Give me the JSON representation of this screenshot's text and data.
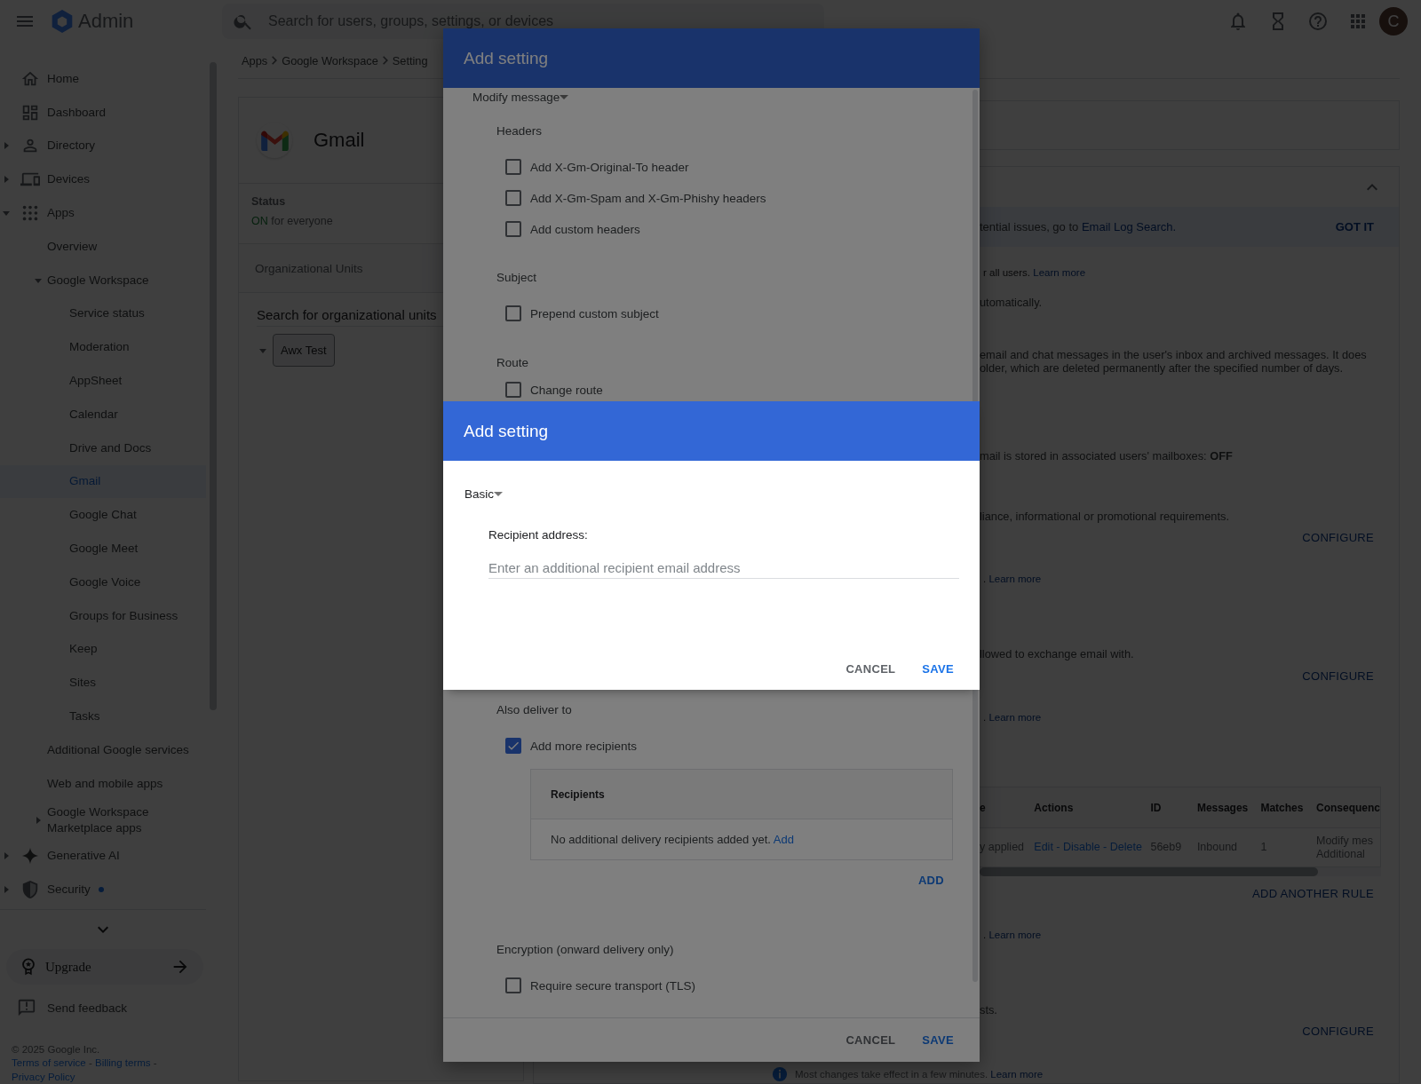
{
  "top_bar": {
    "product": "Admin",
    "search": {
      "placeholder": "Search for users, groups, settings, or devices"
    },
    "avatar": "C"
  },
  "sidebar": {
    "items": [
      {
        "label": "Home",
        "selected": false
      },
      {
        "label": "Dashboard",
        "selected": false
      },
      {
        "label": "Directory",
        "selected": false,
        "expanded": false
      },
      {
        "label": "Devices",
        "selected": false,
        "expanded": false
      },
      {
        "label": "Apps",
        "selected": false,
        "expanded": true,
        "children": [
          {
            "label": "Overview",
            "selected": false
          },
          {
            "label": "Google Workspace",
            "selected": false,
            "expanded": true,
            "children": [
              {
                "label": "Service status",
                "selected": false
              },
              {
                "label": "Moderation",
                "selected": false
              },
              {
                "label": "AppSheet",
                "selected": false
              },
              {
                "label": "Calendar",
                "selected": false
              },
              {
                "label": "Drive and Docs",
                "selected": false
              },
              {
                "label": "Gmail",
                "selected": true
              },
              {
                "label": "Google Chat",
                "selected": false
              },
              {
                "label": "Google Meet",
                "selected": false
              },
              {
                "label": "Google Voice",
                "selected": false
              },
              {
                "label": "Groups for Business",
                "selected": false
              },
              {
                "label": "Keep",
                "selected": false
              },
              {
                "label": "Sites",
                "selected": false
              },
              {
                "label": "Tasks",
                "selected": false
              }
            ]
          },
          {
            "label": "Additional Google services",
            "selected": false
          },
          {
            "label": "Web and mobile apps",
            "selected": false
          },
          {
            "label": "Google Workspace Marketplace apps",
            "selected": false,
            "expanded": false
          }
        ]
      },
      {
        "label": "Generative AI",
        "selected": false,
        "expanded": false
      },
      {
        "label": "Security",
        "selected": false,
        "expanded": false,
        "notification": true
      }
    ],
    "upgrade": "Upgrade",
    "feedback": "Send feedback",
    "copyright": "© 2025 Google Inc.",
    "legal_links": [
      {
        "label": "Terms of service",
        "separator": "-"
      },
      {
        "label": "Billing terms",
        "separator": "-"
      },
      {
        "label": "Privacy Policy"
      }
    ]
  },
  "breadcrumb": [
    "Apps",
    "Google Workspace",
    "Setting"
  ],
  "app_card": {
    "title": "Gmail",
    "status_label": "Status",
    "status_value": "ON",
    "status_scope": "for everyone",
    "ou_heading": "Organizational Units",
    "ou_search": {
      "placeholder": "Search for organizational units"
    },
    "ou_tree": [
      {
        "name": "Awx Test",
        "expanded": true,
        "selected": true
      }
    ]
  },
  "settings_panel": {
    "items": [
      {
        "kind": "banner",
        "text": "tential issues, go to ",
        "link": "Email Log Search.",
        "action": "GOT IT"
      },
      {
        "kind": "note",
        "text": "r all users. ",
        "link": "Learn more"
      },
      {
        "kind": "text",
        "text": "utomatically."
      },
      {
        "kind": "text",
        "text": "email and chat messages in the user's inbox and archived messages. It does"
      },
      {
        "kind": "text",
        "text": "older, which are deleted permanently after the specified number of days."
      },
      {
        "kind": "text",
        "text": "mail is stored in associated users' mailboxes: **OFF**"
      },
      {
        "kind": "text",
        "text": "liance, informational or promotional requirements."
      },
      {
        "kind": "button",
        "text": "CONFIGURE"
      },
      {
        "kind": "note",
        "text": ". ",
        "link": "Learn more"
      },
      {
        "kind": "text",
        "text": "llowed to exchange email with."
      },
      {
        "kind": "button",
        "text": "CONFIGURE"
      },
      {
        "kind": "note",
        "text": ". ",
        "link": "Learn more"
      },
      {
        "kind": "table",
        "columns": [
          "e",
          "Actions",
          "ID",
          "Messages",
          "Matches",
          "Consequenc"
        ],
        "rows": [
          [
            "y applied",
            "Edit - Disable - Delete",
            "56eb9",
            "Inbound",
            "1",
            "Modify mes\nAdditional"
          ]
        ]
      },
      {
        "kind": "button",
        "text": "ADD ANOTHER RULE"
      },
      {
        "kind": "note",
        "text": ". ",
        "link": "Learn more"
      },
      {
        "kind": "text",
        "text": "sts."
      },
      {
        "kind": "button",
        "text": "CONFIGURE"
      },
      {
        "kind": "info",
        "text": "Most changes take effect in a few minutes. ",
        "link": "Learn more"
      }
    ]
  },
  "rule_dialog": {
    "title": "Add setting",
    "action": "Modify message",
    "sections": [
      {
        "heading": "Headers",
        "options": [
          {
            "label": "Add X-Gm-Original-To header",
            "checked": false
          },
          {
            "label": "Add X-Gm-Spam and X-Gm-Phishy headers",
            "checked": false
          },
          {
            "label": "Add custom headers",
            "checked": false
          }
        ]
      },
      {
        "heading": "Subject",
        "options": [
          {
            "label": "Prepend custom subject",
            "checked": false
          }
        ]
      },
      {
        "heading": "Route",
        "options": [
          {
            "label": "Change route",
            "checked": false
          }
        ]
      },
      {
        "heading": "Also deliver to",
        "options": [
          {
            "label": "Add more recipients",
            "checked": true
          }
        ],
        "recipients": {
          "column": "Recipients",
          "empty_text": "No additional delivery recipients added yet. ",
          "empty_link": "Add",
          "add_button": "ADD"
        }
      },
      {
        "heading": "Encryption (onward delivery only)",
        "options": [
          {
            "label": "Require secure transport (TLS)",
            "checked": false
          }
        ]
      }
    ],
    "buttons": [
      {
        "label": "CANCEL",
        "kind": "secondary"
      },
      {
        "label": "SAVE",
        "kind": "primary"
      }
    ]
  },
  "recipient_dialog": {
    "title": "Add setting",
    "mode": "Basic",
    "field_label": "Recipient address:",
    "field": {
      "placeholder": "Enter an additional recipient email address"
    },
    "buttons": [
      {
        "label": "CANCEL",
        "kind": "secondary"
      },
      {
        "label": "SAVE",
        "kind": "primary"
      }
    ]
  }
}
